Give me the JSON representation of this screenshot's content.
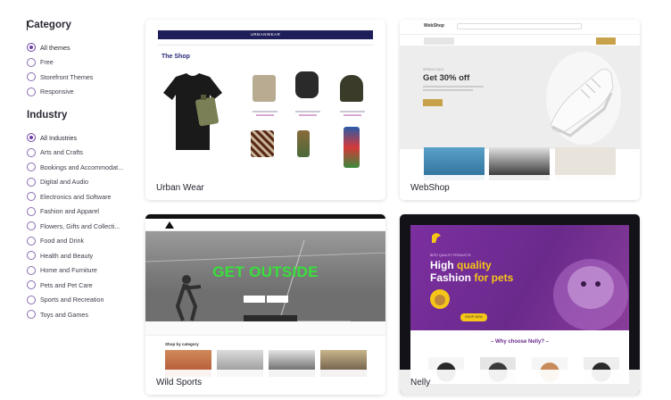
{
  "sidebar": {
    "category": {
      "title": "Category",
      "options": [
        {
          "label": "All themes",
          "checked": true
        },
        {
          "label": "Free",
          "checked": false
        },
        {
          "label": "Storefront Themes",
          "checked": false
        },
        {
          "label": "Responsive",
          "checked": false
        }
      ]
    },
    "industry": {
      "title": "Industry",
      "options": [
        {
          "label": "All Industries",
          "checked": true
        },
        {
          "label": "Arts and Crafts",
          "checked": false
        },
        {
          "label": "Bookings and Accommodat...",
          "checked": false
        },
        {
          "label": "Digital and Audio",
          "checked": false
        },
        {
          "label": "Electronics and Software",
          "checked": false
        },
        {
          "label": "Fashion and Apparel",
          "checked": false
        },
        {
          "label": "Flowers, Gifts and Collecti...",
          "checked": false
        },
        {
          "label": "Food and Drink",
          "checked": false
        },
        {
          "label": "Health and Beauty",
          "checked": false
        },
        {
          "label": "Home and Furniture",
          "checked": false
        },
        {
          "label": "Pets and Pet Care",
          "checked": false
        },
        {
          "label": "Sports and Recreation",
          "checked": false
        },
        {
          "label": "Toys and Games",
          "checked": false
        }
      ]
    }
  },
  "themes": [
    {
      "name": "Urban Wear",
      "preview": {
        "logo": "URBANWEAR",
        "heading": "The Shop"
      }
    },
    {
      "name": "WebShop",
      "preview": {
        "logo": "WebShop",
        "kicker": "SPRING SALE",
        "heading": "Get 30% off"
      }
    },
    {
      "name": "Wild Sports",
      "preview": {
        "heading": "GET OUTSIDE",
        "section": "Shop by category"
      }
    },
    {
      "name": "Nelly",
      "preview": {
        "kicker": "BEST QUALITY PRODUCTS",
        "heading_part1": "High ",
        "heading_highlight1": "quality",
        "heading_part2": "Fashion ",
        "heading_highlight2": "for pets",
        "cta": "SHOP NOW",
        "section": "– Why choose Nelly? –"
      }
    }
  ],
  "colors": {
    "radio_accent": "#6a3fa5",
    "urban_nav": "#1e1e5a",
    "webshop_gold": "#c8a24b",
    "wildsports_green": "#37e03a",
    "nelly_purple": "#6a2a8c",
    "nelly_yellow": "#f5c518"
  }
}
